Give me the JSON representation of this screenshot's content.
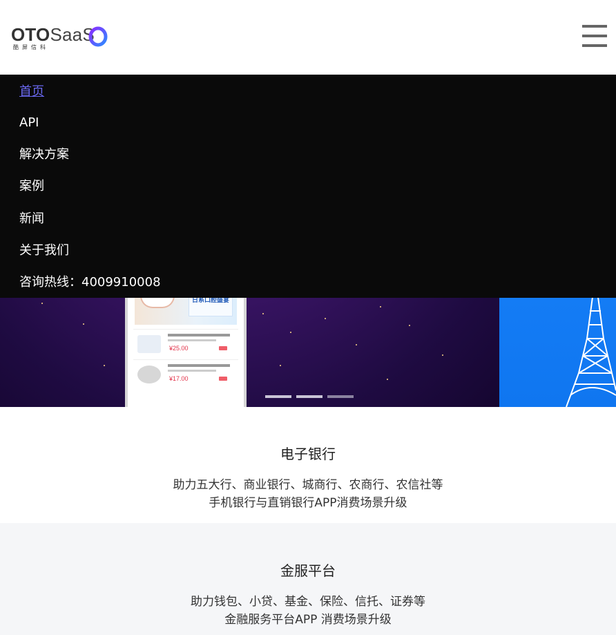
{
  "header": {
    "logo": {
      "text_bold": "OTO",
      "text_light": "SaaS",
      "subtitle": "酷屏信科"
    },
    "menu_icon": "hamburger-icon"
  },
  "menu": {
    "items": [
      {
        "label": "首页",
        "active": true
      },
      {
        "label": "API",
        "active": false
      },
      {
        "label": "解决方案",
        "active": false
      },
      {
        "label": "案例",
        "active": false
      },
      {
        "label": "新闻",
        "active": false
      },
      {
        "label": "关于我们",
        "active": false
      },
      {
        "label": "咨询热线：4009910008",
        "active": false
      }
    ]
  },
  "banner": {
    "phone_box_title": "日系口腔盛宴",
    "products": [
      {
        "price": "¥25.00"
      },
      {
        "price": "¥17.00"
      }
    ],
    "slides_count": 3,
    "active_slide": 1
  },
  "sections": [
    {
      "title": "电子银行",
      "desc_line1": "助力五大行、商业银行、城商行、农商行、农信社等",
      "desc_line2": "手机银行与直销银行APP消费场景升级"
    },
    {
      "title": "金服平台",
      "desc_line1": "助力钱包、小贷、基金、保险、信托、证券等",
      "desc_line2": "金融服务平台APP 消费场景升级"
    }
  ],
  "colors": {
    "menu_bg": "#0a0a0a",
    "menu_active": "#6a68f0",
    "section_alt_bg": "#f5f6f8",
    "logo_ring_start": "#7a3cff",
    "logo_ring_end": "#3b8bff"
  }
}
